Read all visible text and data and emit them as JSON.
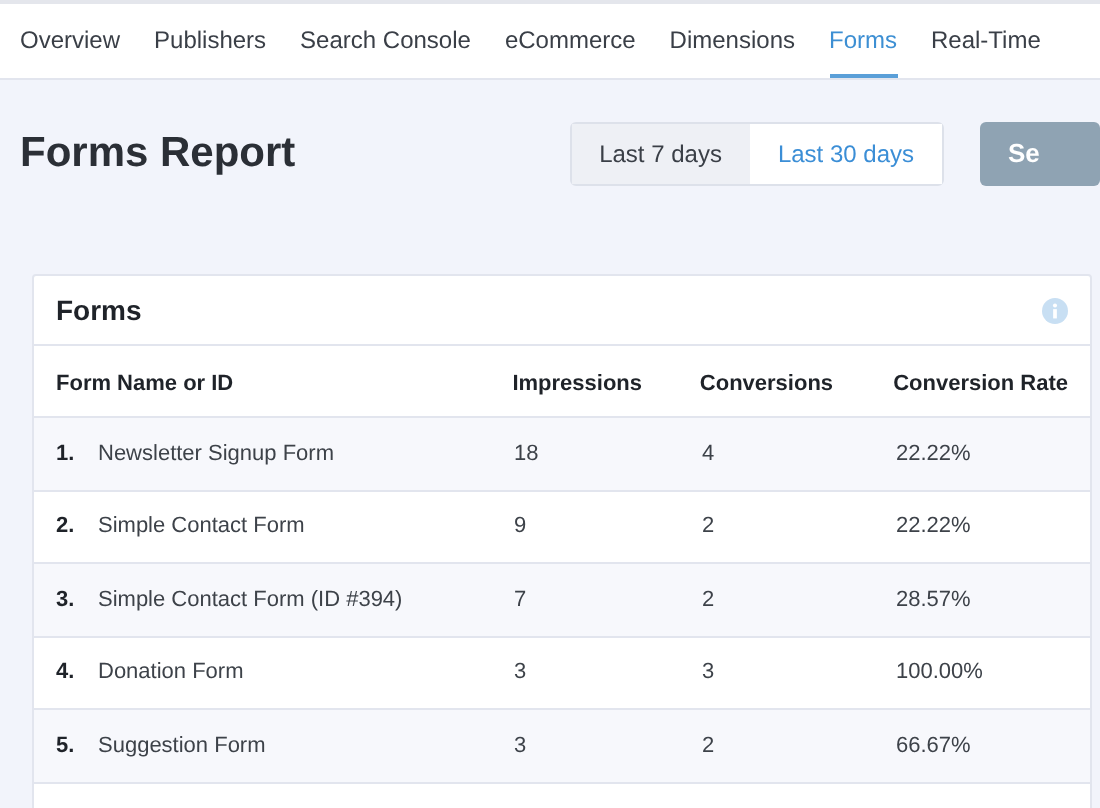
{
  "tabs": [
    {
      "label": "Overview",
      "selected": false
    },
    {
      "label": "Publishers",
      "selected": false
    },
    {
      "label": "Search Console",
      "selected": false
    },
    {
      "label": "eCommerce",
      "selected": false
    },
    {
      "label": "Dimensions",
      "selected": false
    },
    {
      "label": "Forms",
      "selected": true
    },
    {
      "label": "Real-Time",
      "selected": false
    }
  ],
  "page_title": "Forms Report",
  "date_ranges": [
    {
      "label": "Last 7 days",
      "selected": false
    },
    {
      "label": "Last 30 days",
      "selected": true
    }
  ],
  "action_button": "Se",
  "card": {
    "title": "Forms",
    "columns": [
      "Form Name or ID",
      "Impressions",
      "Conversions",
      "Conversion Rate"
    ],
    "rows": [
      {
        "number": "1.",
        "name": "Newsletter Signup Form",
        "impressions": "18",
        "conversions": "4",
        "rate": "22.22%"
      },
      {
        "number": "2.",
        "name": "Simple Contact Form",
        "impressions": "9",
        "conversions": "2",
        "rate": "22.22%"
      },
      {
        "number": "3.",
        "name": "Simple Contact Form (ID #394)",
        "impressions": "7",
        "conversions": "2",
        "rate": "28.57%"
      },
      {
        "number": "4.",
        "name": "Donation Form",
        "impressions": "3",
        "conversions": "3",
        "rate": "100.00%"
      },
      {
        "number": "5.",
        "name": "Suggestion Form",
        "impressions": "3",
        "conversions": "2",
        "rate": "66.67%"
      }
    ]
  }
}
